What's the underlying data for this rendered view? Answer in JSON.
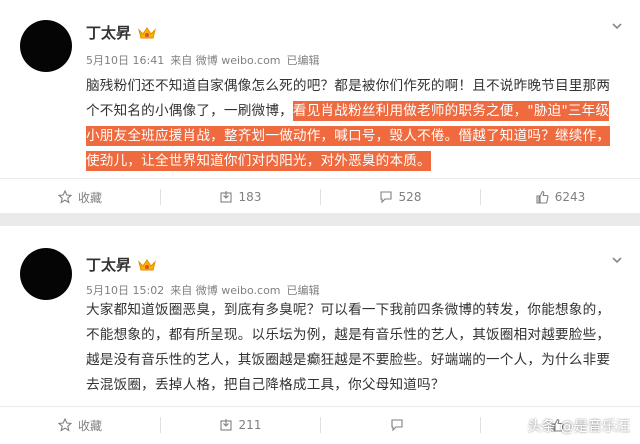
{
  "posts": [
    {
      "author": "丁太昇",
      "date": "5月10日 16:41",
      "source": "来自 微博 weibo.com",
      "edited": "已编辑",
      "text_plain": "脑残粉们还不知道自家偶像怎么死的吧？都是被你们作死的啊！且不说昨晚节目里那两个不知名的小偶像了，一刷微博，",
      "text_highlight": "看见肖战粉丝利用做老师的职务之便，\"胁迫\"三年级小朋友全班应援肖战，整齐划一做动作，喊口号，毁人不倦。僭越了知道吗？继续作，使劲儿，让全世界知道你们对内阳光，对外恶臭的本质。",
      "actions": {
        "collect": "收藏",
        "repost": "183",
        "comment": "528",
        "like": "6243"
      }
    },
    {
      "author": "丁太昇",
      "date": "5月10日 15:02",
      "source": "来自 微博 weibo.com",
      "edited": "已编辑",
      "text_plain": "大家都知道饭圈恶臭，到底有多臭呢？可以看一下我前四条微博的转发，你能想象的，不能想象的，都有所呈现。以乐坛为例，越是有音乐性的艺人，其饭圈相对越要脸些，越是没有音乐性的艺人，其饭圈越是癫狂越是不要脸些。好端端的一个人，为什么非要去混饭圈，丢掉人格，把自己降格成工具，你父母知道吗？",
      "actions": {
        "collect": "收藏",
        "repost": "211",
        "comment": "",
        "like": ""
      }
    }
  ],
  "watermark": "头条 @是音乐汪",
  "colors": {
    "highlight": "#ef6a3e",
    "meta": "#808080",
    "background": "#eaeaea"
  }
}
